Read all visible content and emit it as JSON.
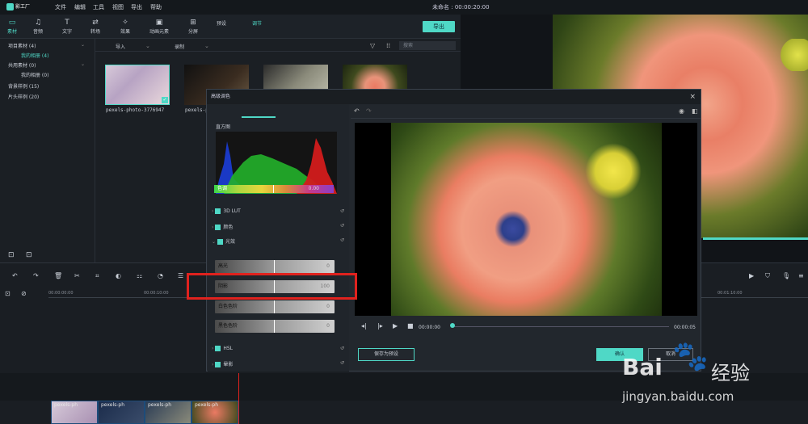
{
  "app": {
    "logo_text": "影工厂",
    "title": "未命名",
    "time": "00:00:20:00"
  },
  "menu": [
    "文件",
    "编辑",
    "工具",
    "视图",
    "导出",
    "帮助"
  ],
  "toolbar": {
    "tabs": [
      {
        "label": "素材",
        "icon": "folder-icon"
      },
      {
        "label": "音频",
        "icon": "music-icon"
      },
      {
        "label": "文字",
        "icon": "text-icon"
      },
      {
        "label": "转场",
        "icon": "transition-icon"
      },
      {
        "label": "效果",
        "icon": "effects-icon"
      },
      {
        "label": "动画元素",
        "icon": "image-icon"
      },
      {
        "label": "分屏",
        "icon": "splitscreen-icon"
      }
    ],
    "export_label": "导出"
  },
  "sidebar": {
    "items": [
      {
        "label": "项目素材 (4)"
      },
      {
        "label": "我的相册 (4)"
      },
      {
        "label": "共用素材 (0)"
      },
      {
        "label": "我的相册 (0)"
      },
      {
        "label": "背景样例 (15)"
      },
      {
        "label": "片头样例 (20)"
      }
    ]
  },
  "media": {
    "import_label": "导入",
    "record_label": "录制",
    "search_placeholder": "搜索",
    "thumb_caption": "pexels-photo-3776947",
    "thumb_caption_2": "pexels-p"
  },
  "timeline": {
    "ruler": [
      "00:00:00:00",
      "00:00:10:00",
      "00:01:10:00"
    ],
    "clips": [
      "pexels-ph",
      "pexels-ph",
      "pexels-ph",
      "pexels-ph"
    ]
  },
  "dialog": {
    "title": "高级调色",
    "tabs": [
      "预设",
      "调节"
    ],
    "histogram_label": "直方图",
    "hue_label": "色调",
    "hue_value": "0.00",
    "sections": [
      "3D LUT",
      "颜色",
      "光效",
      "HSL",
      "晕影"
    ],
    "sliders": [
      {
        "label": "高光",
        "value": "0"
      },
      {
        "label": "阴影",
        "value": "100"
      },
      {
        "label": "白色色阶",
        "value": "0"
      },
      {
        "label": "黑色色阶",
        "value": "0"
      }
    ],
    "time_current": "00:00:00",
    "time_total": "00:00:05",
    "save_preset_label": "保存为预设",
    "ok_label": "确认",
    "cancel_label": "取消"
  },
  "watermark": {
    "brand": "Bai",
    "brand_cn": "经验",
    "url": "jingyan.baidu.com"
  }
}
